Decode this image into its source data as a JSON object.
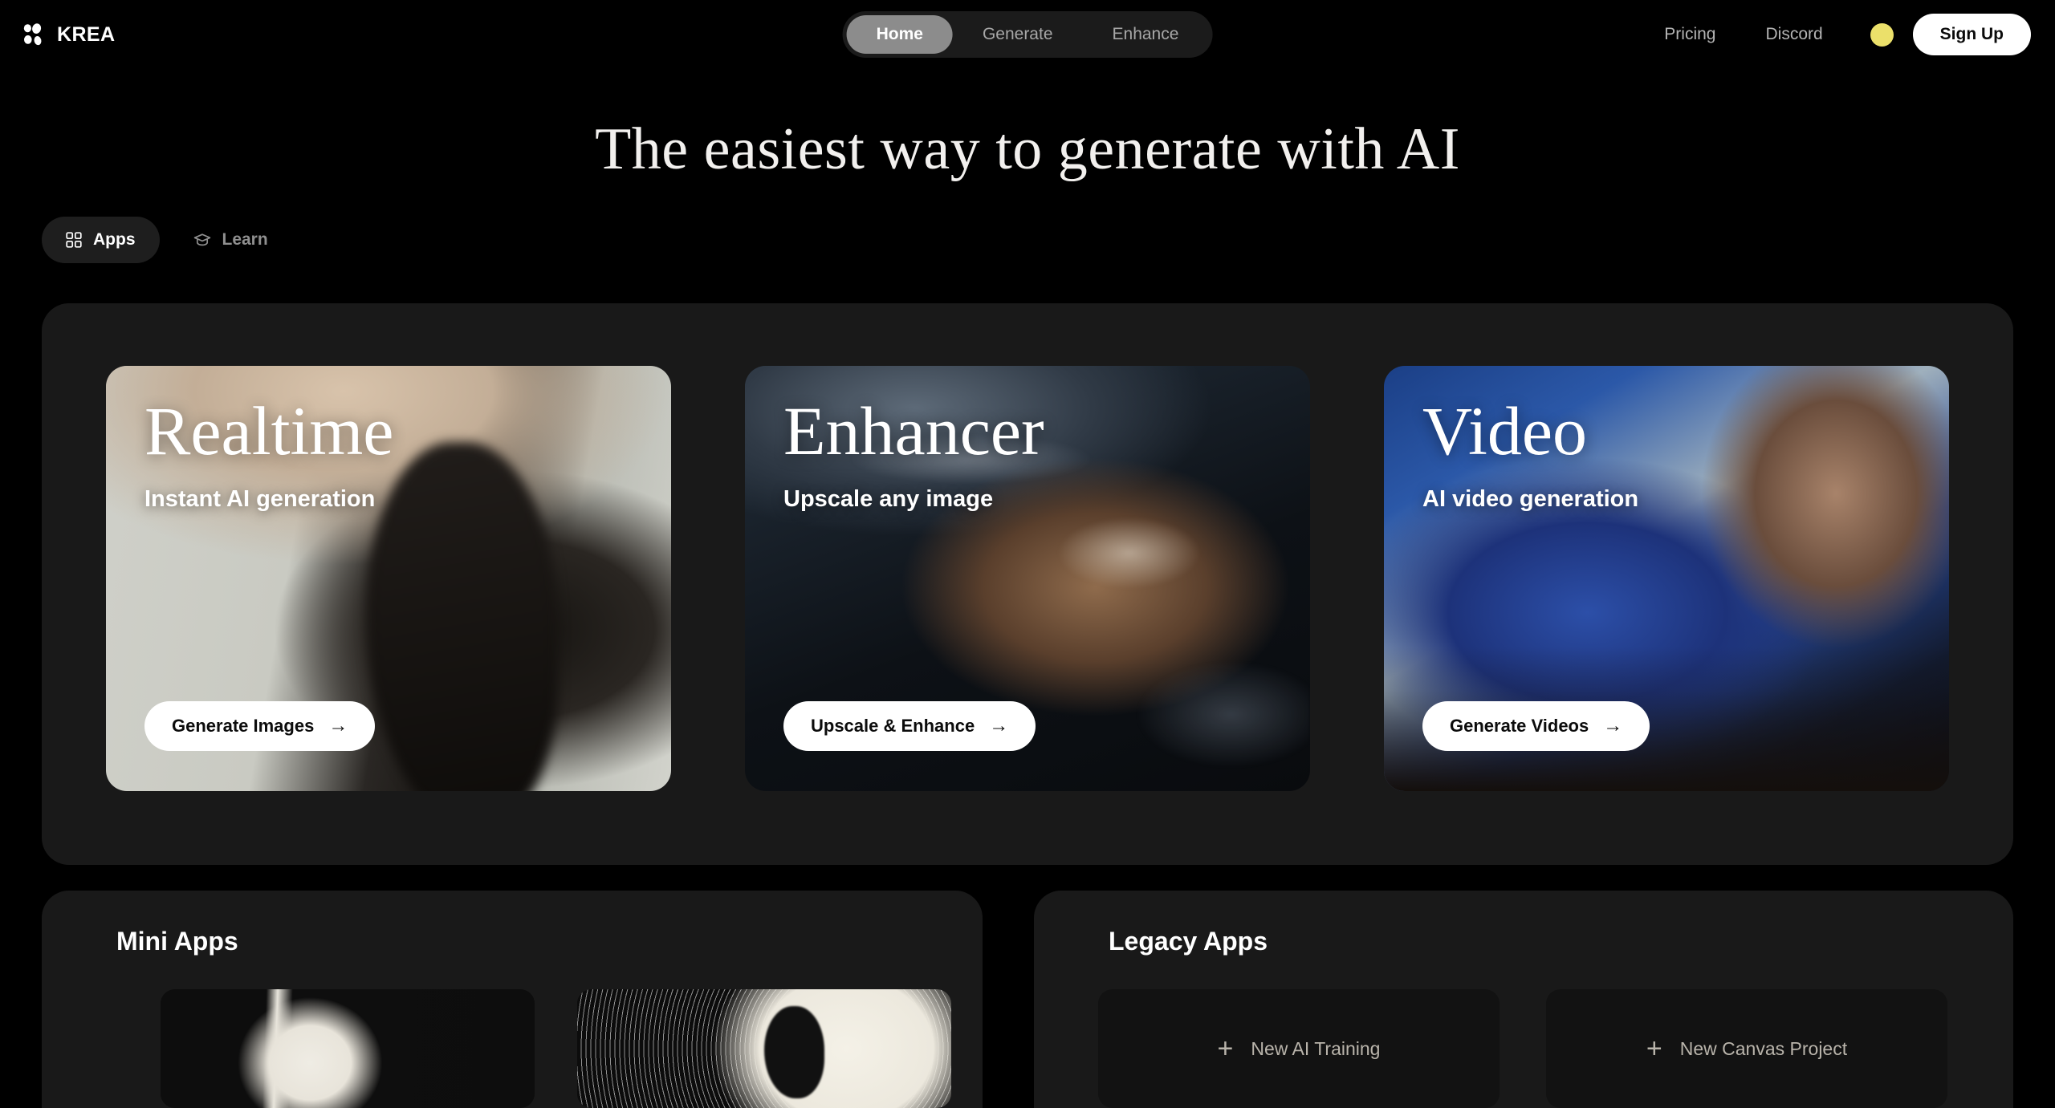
{
  "header": {
    "brand_name": "KREA",
    "logo_icon": "krea-logo-icon",
    "nav": [
      {
        "label": "Home",
        "active": true
      },
      {
        "label": "Generate",
        "active": false
      },
      {
        "label": "Enhance",
        "active": false
      }
    ],
    "links": [
      {
        "label": "Pricing"
      },
      {
        "label": "Discord"
      }
    ],
    "avatar_color": "#ebe06a",
    "signup_label": "Sign Up"
  },
  "hero": {
    "headline": "The easiest way to generate with AI"
  },
  "tabs": [
    {
      "label": "Apps",
      "icon": "grid-icon",
      "active": true
    },
    {
      "label": "Learn",
      "icon": "graduation-cap-icon",
      "active": false
    }
  ],
  "apps": {
    "cards": [
      {
        "title": "Realtime",
        "subtitle": "Instant AI generation",
        "button_label": "Generate Images",
        "button_arrow": "→"
      },
      {
        "title": "Enhancer",
        "subtitle": "Upscale any image",
        "button_label": "Upscale & Enhance",
        "button_arrow": "→"
      },
      {
        "title": "Video",
        "subtitle": "AI video generation",
        "button_label": "Generate Videos",
        "button_arrow": "→"
      }
    ]
  },
  "mini_apps": {
    "title": "Mini Apps",
    "items": [
      {
        "art": "monochrome-profile-illustration"
      },
      {
        "art": "halftone-portrait-illustration"
      }
    ]
  },
  "legacy_apps": {
    "title": "Legacy Apps",
    "items": [
      {
        "label": "New AI Training",
        "icon": "plus-icon"
      },
      {
        "label": "New Canvas Project",
        "icon": "plus-icon"
      }
    ]
  },
  "colors": {
    "background": "#000000",
    "panel": "#191919",
    "accent_white": "#ffffff",
    "avatar": "#ebe06a",
    "muted_text": "#b4b4b4"
  }
}
